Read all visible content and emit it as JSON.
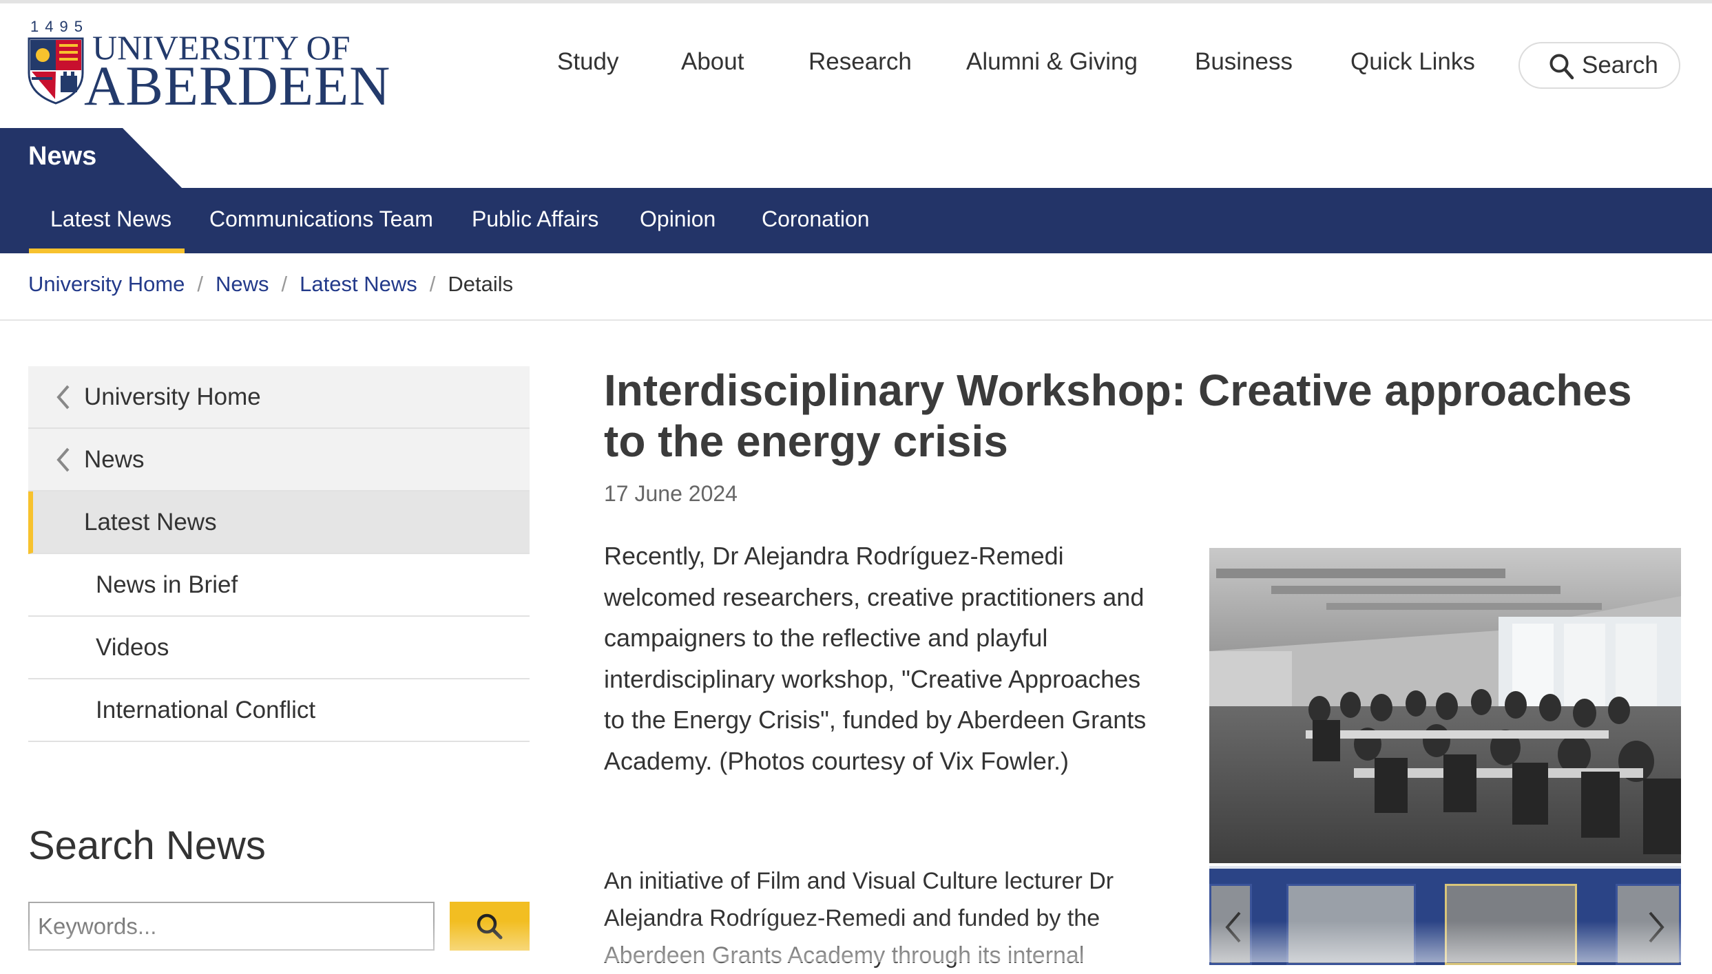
{
  "logo": {
    "year": "1495",
    "line1": "UNIVERSITY OF",
    "line2": "ABERDEEN"
  },
  "main_nav": [
    "Study",
    "About",
    "Research",
    "Alumni & Giving",
    "Business",
    "Quick Links"
  ],
  "search_button": "Search",
  "section_label": "News",
  "sub_nav": {
    "active_index": 0,
    "items": [
      "Latest News",
      "Communications Team",
      "Public Affairs",
      "Opinion",
      "Coronation"
    ]
  },
  "breadcrumb": {
    "items": [
      "University Home",
      "News",
      "Latest News"
    ],
    "current": "Details"
  },
  "side_nav": {
    "items": [
      {
        "label": "University Home",
        "back": true
      },
      {
        "label": "News",
        "back": true
      },
      {
        "label": "Latest News",
        "active": true
      },
      {
        "label": "News in Brief"
      },
      {
        "label": "Videos"
      },
      {
        "label": "International Conflict"
      }
    ]
  },
  "search_news": {
    "heading": "Search News",
    "placeholder": "Keywords..."
  },
  "article": {
    "title": "Interdisciplinary Workshop: Creative approaches to the energy crisis",
    "date": "17 June 2024",
    "paragraph1": "Recently, Dr Alejandra Rodríguez-Remedi welcomed researchers, creative practitioners and campaigners to the reflective and playful interdisciplinary workshop, \"Creative Approaches to the Energy Crisis\", funded by Aberdeen Grants Academy. (Photos courtesy of Vix Fowler.)",
    "paragraph2": "An initiative of Film and Visual Culture lecturer Dr Alejandra Rodríguez-Remedi and funded by the Aberdeen Grants Academy through its internal"
  },
  "colors": {
    "navy": "#233468",
    "gold": "#f7c22e",
    "link": "#233a8a"
  },
  "icons": [
    "search-icon",
    "chevron-left-icon",
    "chevron-right-icon",
    "crest-icon"
  ]
}
